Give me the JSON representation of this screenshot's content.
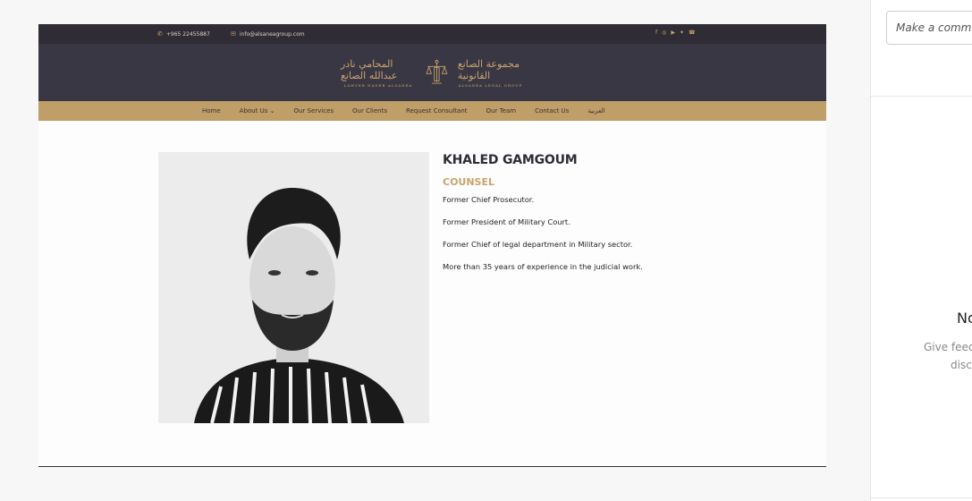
{
  "topbar": {
    "phone": "+965 22455887",
    "email": "info@alsaneagroup.com",
    "socials": [
      "f",
      "◎",
      "▶",
      "✦",
      "☎"
    ]
  },
  "logo": {
    "left_arabic": "المحامي نادر عبدالله الصانع",
    "left_sub": "LAWYER NADER ALSANEA",
    "right_arabic": "مجموعة الصانع القانونية",
    "right_sub": "ALSANEA LEGAL GROUP"
  },
  "nav": {
    "items": [
      "Home",
      "About Us ⌄",
      "Our Services",
      "Our Clients",
      "Request Consultant",
      "Our Team",
      "Contact Us",
      "العربية"
    ]
  },
  "profile": {
    "name": "KHALED GAMGOUM",
    "role": "COUNSEL",
    "bullets": [
      "Former Chief Prosecutor.",
      "Former President of  Military Court.",
      "Former Chief of legal department in Military sector.",
      "More than 35 years of experience in the judicial work."
    ]
  },
  "panel": {
    "comment_placeholder": "Make a comment",
    "empty_title": "No",
    "empty_line1": "Give feed",
    "empty_line2": "discu"
  },
  "colors": {
    "dark": "#2f2c35",
    "gold": "#c8a46a",
    "nav": "#bf9e67"
  }
}
